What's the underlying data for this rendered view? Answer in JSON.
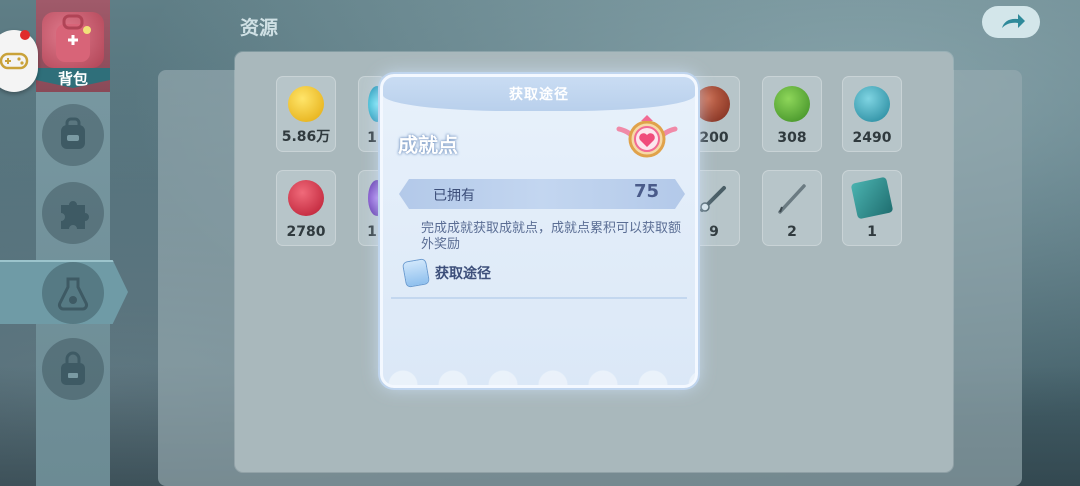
{
  "header": {
    "title": "资源",
    "back_icon": "back-arrow-icon"
  },
  "sidebar": {
    "active_label": "背包",
    "items": [
      {
        "icon": "backpack-icon"
      },
      {
        "icon": "puzzle-icon"
      },
      {
        "icon": "potion-icon"
      },
      {
        "icon": "bag-icon"
      }
    ]
  },
  "inventory": {
    "items": [
      {
        "count": "5.86万",
        "color": "#f5c518"
      },
      {
        "count": "1",
        "color": "#2fb6d0"
      },
      {
        "count": "200",
        "color": "#9a3b28"
      },
      {
        "count": "308",
        "color": "#5fae3e"
      },
      {
        "count": "2490",
        "color": "#3aa0b5"
      },
      {
        "count": "2780",
        "color": "#d2344a"
      },
      {
        "count": "1",
        "color": "#7a4bc2"
      },
      {
        "count": "9",
        "color": "#8aa0aa"
      },
      {
        "count": "2",
        "color": "#9aa8ae"
      },
      {
        "count": "1",
        "color": "#2e8f8f"
      }
    ]
  },
  "dialog": {
    "header": "获取途径",
    "title": "成就点",
    "owned_label": "已拥有",
    "owned_value": "75",
    "description": "完成成就获取成就点，成就点累积可以获取额外奖励",
    "source_label": "获取途径",
    "badge_icon": "heart-badge-icon"
  }
}
